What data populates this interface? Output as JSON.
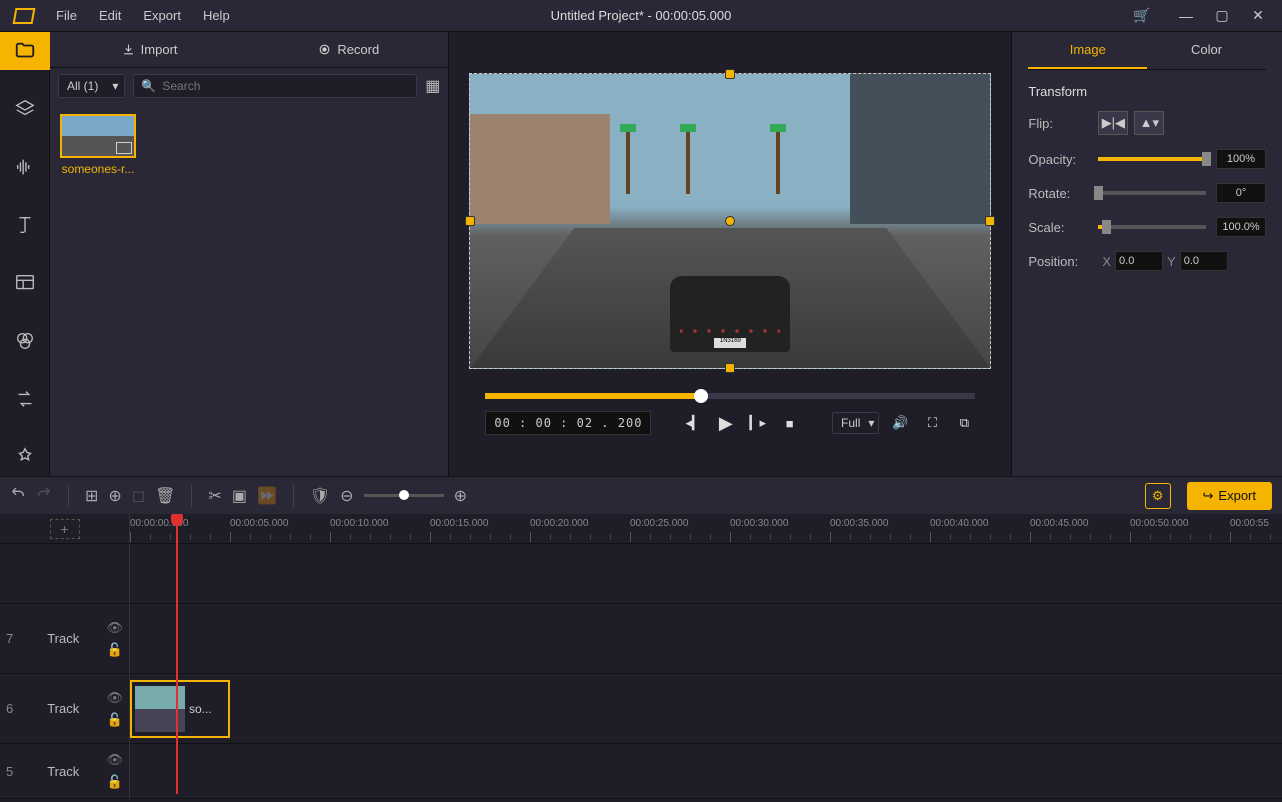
{
  "menubar": {
    "file": "File",
    "edit": "Edit",
    "export": "Export",
    "help": "Help"
  },
  "title": "Untitled Project* - 00:00:05.000",
  "media": {
    "import": "Import",
    "record": "Record",
    "filter": "All (1)",
    "search_placeholder": "Search",
    "items": [
      {
        "name": "someones-r..."
      }
    ]
  },
  "preview": {
    "playbar_percent": 44,
    "timecode": "00 : 00 : 02 . 200",
    "fit": "Full"
  },
  "properties": {
    "tabs": {
      "image": "Image",
      "color": "Color"
    },
    "section": "Transform",
    "flip": "Flip:",
    "opacity": {
      "label": "Opacity:",
      "value": "100%",
      "percent": 100
    },
    "rotate": {
      "label": "Rotate:",
      "value": "0°",
      "percent": 0
    },
    "scale": {
      "label": "Scale:",
      "value": "100.0%",
      "percent": 7
    },
    "position": {
      "label": "Position:",
      "xLabel": "X",
      "xValue": "0.0",
      "yLabel": "Y",
      "yValue": "0.0"
    }
  },
  "exportBtn": "Export",
  "timeline": {
    "ticks": [
      "00:00:00.000",
      "00:00:05.000",
      "00:00:10.000",
      "00:00:15.000",
      "00:00:20.000",
      "00:00:25.000",
      "00:00:30.000",
      "00:00:35.000",
      "00:00:40.000",
      "00:00:45.000",
      "00:00:50.000",
      "00:00:55"
    ],
    "playhead_percent": 4,
    "tracks": [
      {
        "num": "7",
        "label": "Track"
      },
      {
        "num": "6",
        "label": "Track",
        "clip": {
          "name": "so...",
          "left": 0,
          "width": 100
        }
      },
      {
        "num": "5",
        "label": "Track"
      }
    ]
  }
}
